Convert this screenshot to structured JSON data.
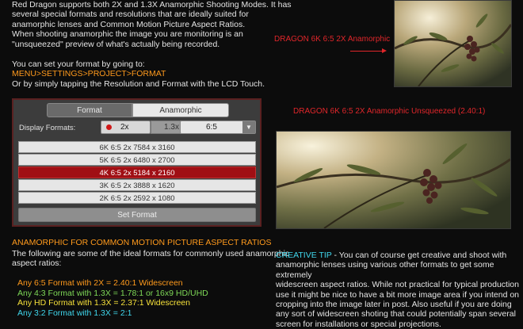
{
  "intro": {
    "line1": "Red Dragon supports both 2X and 1.3X Anamorphic Shooting Modes.  It has",
    "line2": "several special formats and resolutions that are ideally suited for",
    "line3": "anamorphic lenses and Common Motion Picture Aspect Ratios.",
    "line4": "When shooting anamorphic the image you are monitoring is an",
    "line5": "\"unsqueezed\" preview of what's actually being recorded.",
    "line6": "You can set your format by going to:",
    "menu_path": "MENU>SETTINGS>PROJECT>FORMAT",
    "line8": "Or by simply tapping the Resolution and Format with the LCD Touch."
  },
  "camera_ui": {
    "tab_format": "Format",
    "tab_anamorphic": "Anamorphic",
    "display_formats_label": "Display Formats:",
    "btn_2x": "2x",
    "btn_13x": "1.3x",
    "ratio_value": "6:5",
    "ratio_arrow": "▼",
    "formats": [
      "6K 6:5 2x 7584 x 3160",
      "5K 6:5 2x 6480 x 2700",
      "4K 6:5 2x 5184 x 2160",
      "3K 6:5 2x 3888 x 1620",
      "2K 6:5 2x 2592 x 1080"
    ],
    "selected_format": "4K 6:5 2x 5184 x 2160",
    "set_format_label": "Set Format"
  },
  "ratios_section": {
    "heading": "ANAMORPHIC FOR COMMON MOTION PICTURE ASPECT RATIOS",
    "desc1": "The following are some of the ideal formats for commonly used anamorphic",
    "desc2": "aspect ratios:",
    "items": [
      "Any 6:5 Format with 2X = 2.40:1 Widescreen",
      "Any 4:3 Format with 1.3X = 1.78:1 or 16x9 HD/UHD",
      "Any HD Format with 1.3X = 2.37:1 Widescreen",
      "Any 3:2 Format with 1.3X = 2:1"
    ]
  },
  "captions": {
    "top": "DRAGON 6K 6:5 2X Anamorphic",
    "middle": "DRAGON 6K 6:5 2X Anamorphic Unsqueezed (2.40:1)"
  },
  "tip": {
    "label": "CREATIVE TIP",
    "lead": " - You can of course get creative and shoot with",
    "line2": "anamorphic lenses using various other formats to get some extremely",
    "line3": "widescreen aspect ratios.  While not practical for typical production",
    "line4": "use it might be nice to have a bit more image area if you intend on",
    "line5": "cropping into the image later in post.  Also useful if you are doing",
    "line6": "any sort of widescreen shoting that could potentially span several",
    "line7": "screen for installations or special projections."
  },
  "colors": {
    "accent_orange": "#ff9a1c",
    "caption_red": "#e0262a",
    "selected_row": "#a00f14",
    "item_green": "#7ed957",
    "item_cyan": "#40d8ee",
    "item_yellow": "#f7e23a"
  }
}
